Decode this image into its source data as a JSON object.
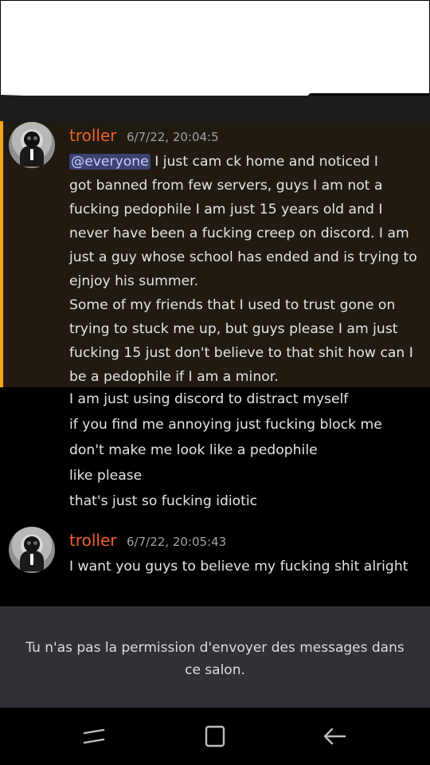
{
  "messages": [
    {
      "username": "troller",
      "timestamp": "6/7/22, 20:04:5",
      "mention": "@everyone",
      "lines": [
        " I just cam   ck home and noticed I",
        "got banned from few servers, guys I am not a",
        "fucking pedophile I am just 15 years old and I",
        "never have been a fucking creep on discord. I am",
        "just a guy whose school has ended and is trying to",
        "ejnjoy his summer.",
        "Some of my friends that I used to trust gone on",
        "trying to stuck me up, but guys please I am just",
        "fucking 15 just don't believe to that shit how can I",
        "be a pedophile if I am a minor."
      ],
      "followups": [
        "I am just using discord to distract myself",
        "if you find me annoying just fucking block me",
        "don't make me look like a pedophile",
        "like please",
        "that's just so fucking idiotic"
      ]
    },
    {
      "username": "troller",
      "timestamp": "6/7/22, 20:05:43",
      "lines": [
        "I want you guys to believe my fucking shit alright"
      ]
    }
  ],
  "permission_notice": "Tu n'as pas la permission d'envoyer des messages dans ce salon.",
  "nav": {
    "recents": "recents-icon",
    "home": "home-icon",
    "back": "back-arrow-icon"
  },
  "colors": {
    "username": "#f0612b",
    "highlight_bg": "#201a10",
    "highlight_border": "#f0a51b",
    "mention_bg": "#3d4270",
    "permission_bar": "#2f3136"
  }
}
